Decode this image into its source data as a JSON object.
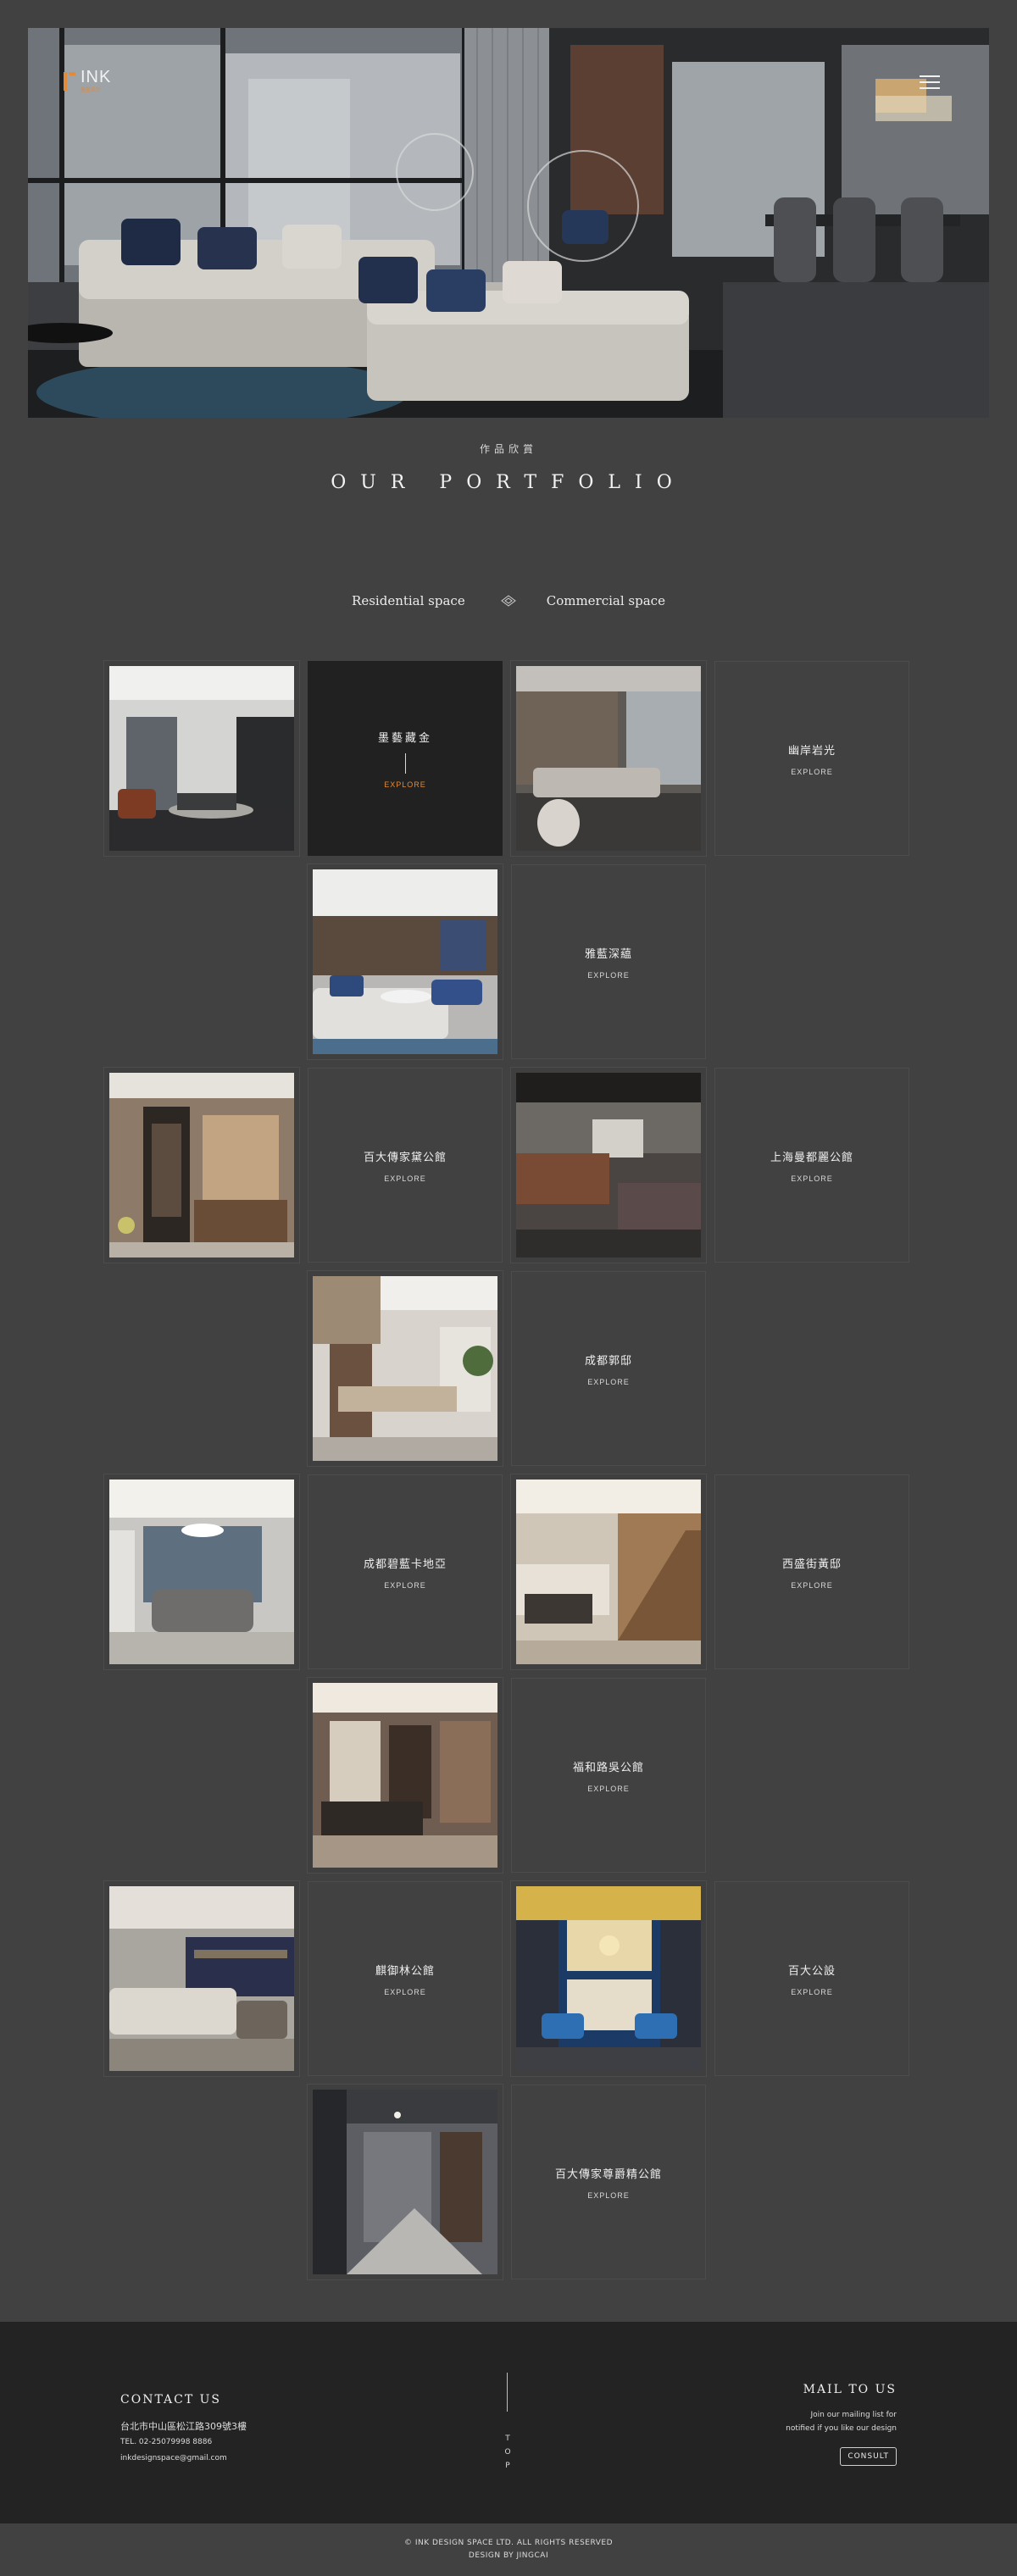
{
  "header": {
    "logo_text": "INK",
    "logo_sub": "墨藝設計"
  },
  "hero": {
    "alt": "Living room interior"
  },
  "portfolio": {
    "subtitle": "作品欣賞",
    "title": "OUR PORTFOLIO",
    "tabs": [
      "Residential space",
      "Commercial space"
    ],
    "explore_label": "EXPLORE",
    "projects": [
      "墨藝藏金",
      "幽岸岩光",
      "雅藍深藴",
      "百大傳家黛公館",
      "上海曼都麗公館",
      "成都郭邸",
      "成都碧藍卡地亞",
      "西盛街黃邸",
      "福和路吳公館",
      "麒御林公館",
      "百大公設",
      "百大傳家尊爵精公館"
    ]
  },
  "footer": {
    "contact_title": "CONTACT US",
    "address": "台北市中山區松江路309號3樓",
    "tel": "TEL. 02-25079998 8886",
    "email": "inkdesignspace@gmail.com",
    "top_label": "TOP",
    "mail_title": "MAIL TO US",
    "mail_line1": "Join our mailing list for",
    "mail_line2": "notified if you like our design",
    "consult": "CONSULT",
    "copyright": "© INK DESIGN SPACE LTD. ALL RIGHTS RESERVED",
    "design_by": "DESIGN BY JINGCAI"
  },
  "colors": {
    "accent": "#e08a3c",
    "background": "#414141",
    "footer": "#232323",
    "active_tile": "#212121"
  }
}
